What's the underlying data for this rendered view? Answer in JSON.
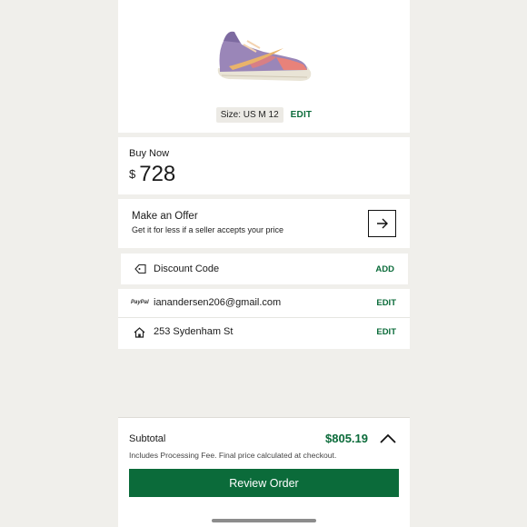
{
  "product": {
    "size_label": "Size: US M 12",
    "size_edit": "EDIT",
    "image_icon": "sneaker-image"
  },
  "buy_now": {
    "label": "Buy Now",
    "currency": "$",
    "amount": "728"
  },
  "offer": {
    "title": "Make an Offer",
    "subtitle": "Get it for less if a seller accepts your price",
    "icon": "arrow-right-icon"
  },
  "discount": {
    "label": "Discount Code",
    "action": "ADD",
    "icon": "tag-icon"
  },
  "payment": {
    "provider_logo": "PayPal",
    "email": "ianandersen206@gmail.com",
    "action": "EDIT"
  },
  "shipping": {
    "address": "253 Sydenham St",
    "action": "EDIT",
    "icon": "home-icon"
  },
  "summary": {
    "subtotal_label": "Subtotal",
    "subtotal_value": "$805.19",
    "note": "Includes Processing Fee. Final price calculated at checkout.",
    "review_label": "Review Order",
    "toggle_icon": "chevron-up-icon"
  },
  "colors": {
    "brand_green": "#0b6b3a",
    "background": "#f0efeb"
  }
}
